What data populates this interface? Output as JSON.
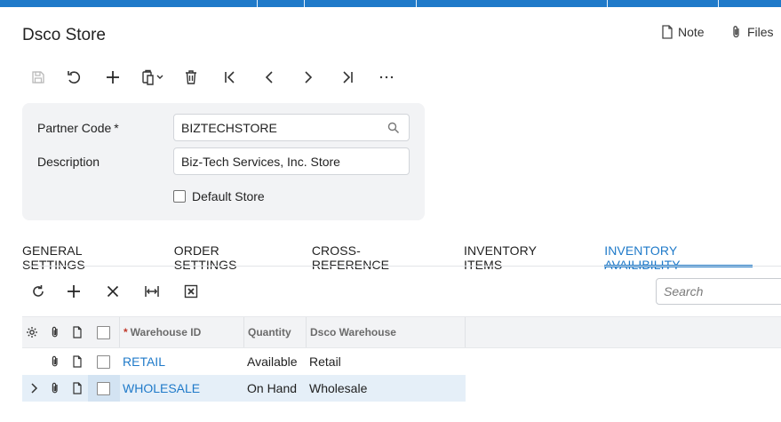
{
  "header": {
    "title": "Dsco Store",
    "note_label": "Note",
    "files_label": "Files"
  },
  "toolbar": {
    "icons": [
      "save-icon",
      "undo-icon",
      "add-icon",
      "copy-paste-icon",
      "delete-icon",
      "first-record-icon",
      "previous-record-icon",
      "next-record-icon",
      "last-record-icon",
      "more-icon"
    ]
  },
  "form": {
    "partner_code_label": "Partner Code",
    "required_mark": "*",
    "partner_code_value": "BIZTECHSTORE",
    "description_label": "Description",
    "description_value": "Biz-Tech Services, Inc. Store",
    "default_store_label": "Default Store",
    "default_store_checked": false
  },
  "tabs": [
    {
      "label": "GENERAL SETTINGS",
      "active": false
    },
    {
      "label": "ORDER SETTINGS",
      "active": false
    },
    {
      "label": "CROSS-REFERENCE",
      "active": false
    },
    {
      "label": "INVENTORY ITEMS",
      "active": false
    },
    {
      "label": "INVENTORY AVAILIBILITY",
      "active": true
    }
  ],
  "grid_toolbar": {
    "icons": [
      "refresh-icon",
      "add-row-icon",
      "delete-row-icon",
      "fit-columns-icon",
      "export-excel-icon"
    ],
    "search_placeholder": "Search"
  },
  "grid": {
    "columns": {
      "warehouse_id": "Warehouse ID",
      "quantity": "Quantity",
      "dsco_warehouse": "Dsco Warehouse"
    },
    "rows": [
      {
        "warehouse_id": "RETAIL",
        "quantity": "Available",
        "dsco_warehouse": "Retail",
        "selected": false
      },
      {
        "warehouse_id": "WHOLESALE",
        "quantity": "On Hand",
        "dsco_warehouse": "Wholesale",
        "selected": true
      }
    ]
  },
  "colors": {
    "accent": "#1f7ac9",
    "form_bg": "#f2f3f5",
    "selected_row": "#e5eff8"
  }
}
